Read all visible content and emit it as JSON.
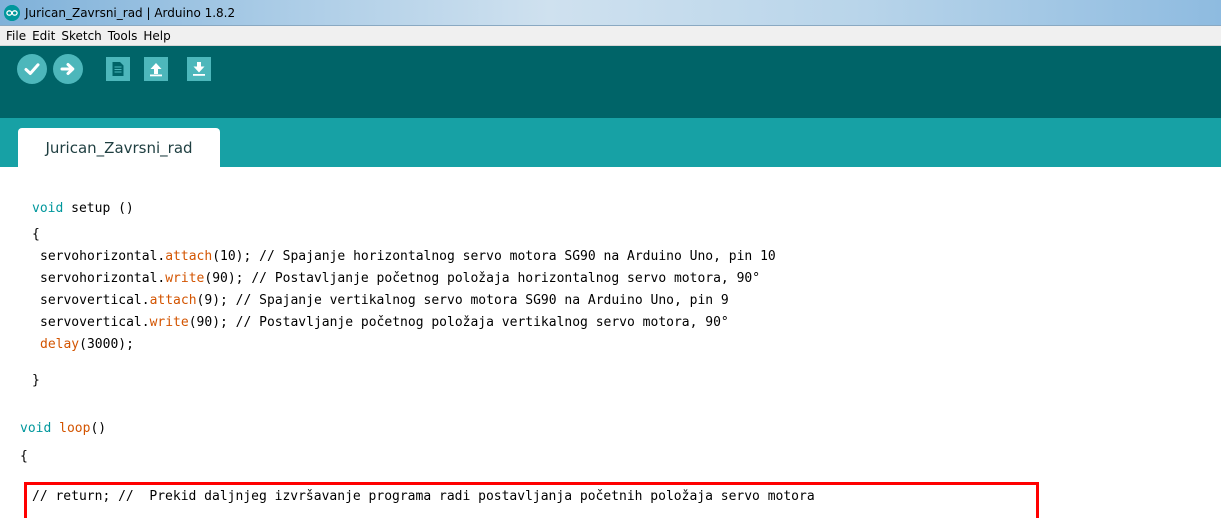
{
  "window": {
    "title": "Jurican_Zavrsni_rad | Arduino 1.8.2"
  },
  "menu": {
    "items": [
      "File",
      "Edit",
      "Sketch",
      "Tools",
      "Help"
    ]
  },
  "toolbar": {
    "buttons": [
      {
        "name": "verify",
        "icon": "check-icon"
      },
      {
        "name": "upload",
        "icon": "arrow-right-icon"
      },
      {
        "name": "new",
        "icon": "new-file-icon"
      },
      {
        "name": "open",
        "icon": "arrow-up-icon"
      },
      {
        "name": "save",
        "icon": "arrow-down-icon"
      }
    ]
  },
  "tabs": [
    {
      "label": "Jurican_Zavrsni_rad",
      "active": true
    }
  ],
  "colors": {
    "toolbar_bg": "#006468",
    "tabstrip_bg": "#17a1a5",
    "button_bg": "#4db7bb",
    "keyword": "#00979c",
    "function": "#d35400",
    "highlight": "#ff0000"
  },
  "code": {
    "l1_kw": "void",
    "l1_rest": " setup ()",
    "l2": "{",
    "l3_a": "servohorizontal.",
    "l3_fn": "attach",
    "l3_b": "(10); // Spajanje horizontalnog servo motora SG90 na Arduino Uno, pin 10",
    "l4_a": "servohorizontal.",
    "l4_fn": "write",
    "l4_b": "(90); // Postavljanje početnog položaja horizontalnog servo motora, 90°",
    "l5_a": "servovertical.",
    "l5_fn": "attach",
    "l5_b": "(9); // Spajanje vertikalnog servo motora SG90 na Arduino Uno, pin 9",
    "l6_a": "servovertical.",
    "l6_fn": "write",
    "l6_b": "(90); // Postavljanje početnog položaja vertikalnog servo motora, 90°",
    "l7_fn": "delay",
    "l7_b": "(3000);",
    "l8": "}",
    "l9_kw": "void",
    "l9_fn": "loop",
    "l9_b": "()",
    "l10": "{",
    "l11": "// return; //  Prekid daljnjeg izvršavanje programa radi postavljanja početnih položaja servo motora"
  }
}
